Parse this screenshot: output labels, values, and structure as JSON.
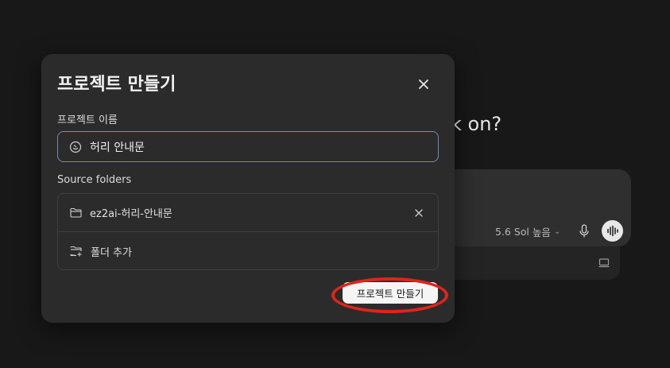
{
  "background": {
    "heading_fragment": "k on?",
    "model_label": "5.6 Sol",
    "effort_label": "높음"
  },
  "modal": {
    "title": "프로젝트 만들기",
    "name_label": "프로젝트 이름",
    "name_value": "허리 안내문",
    "folders_label": "Source folders",
    "folders": [
      {
        "name": "ez2ai-허리-안내문"
      }
    ],
    "add_folder_label": "폴더 추가",
    "create_button_label": "프로젝트 만들기"
  },
  "colors": {
    "annotation_ring": "#e0241b",
    "input_focus_border": "#6f8db3"
  },
  "icons": [
    "close-icon",
    "emoji-icon",
    "folder-icon",
    "folder-add-icon",
    "remove-folder-icon",
    "chevron-down-icon",
    "mic-icon",
    "voice-icon",
    "screen-icon"
  ]
}
